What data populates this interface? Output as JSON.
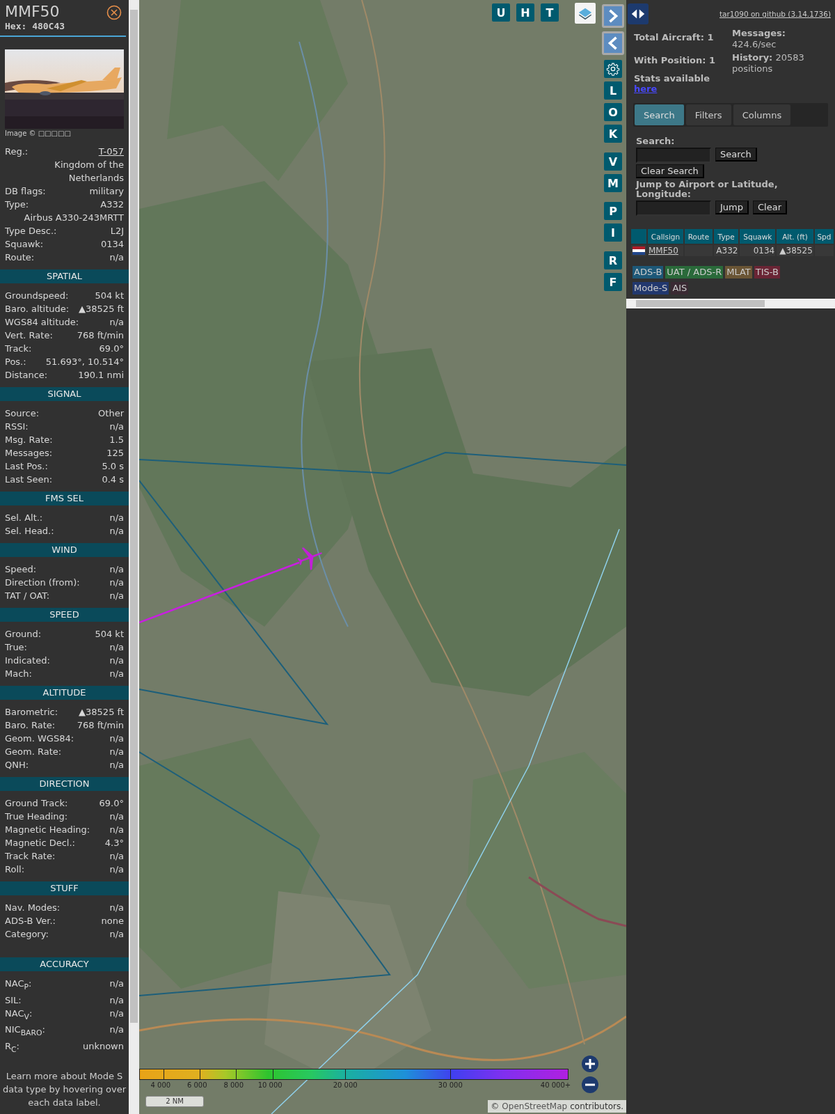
{
  "aircraft": {
    "callsign": "MMF50",
    "hex": "Hex: 480C43",
    "photo_caption": "Image © □□□□□"
  },
  "info_rows": [
    {
      "label": "Reg.:",
      "value": "T-057",
      "link": true
    },
    {
      "value": "Kingdom of the Netherlands"
    },
    {
      "label": "DB flags:",
      "value": "military"
    },
    {
      "label": "Type:",
      "value": "A332"
    },
    {
      "value": "Airbus A330-243MRTT"
    },
    {
      "label": "Type Desc.:",
      "value": "L2J"
    },
    {
      "label": "Squawk:",
      "value": "0134"
    },
    {
      "label": "Route:",
      "value": "n/a"
    }
  ],
  "sections": [
    {
      "title": "SPATIAL",
      "rows": [
        {
          "label": "Groundspeed:",
          "value": "504 kt"
        },
        {
          "label": "Baro. altitude:",
          "value": "▲38525 ft"
        },
        {
          "label": "WGS84 altitude:",
          "value": "n/a"
        },
        {
          "label": "Vert. Rate:",
          "value": "768 ft/min"
        },
        {
          "label": "Track:",
          "value": "69.0°"
        },
        {
          "label": "Pos.:",
          "value": "51.693°, 10.514°"
        },
        {
          "label": "Distance:",
          "value": "190.1 nmi"
        }
      ]
    },
    {
      "title": "SIGNAL",
      "rows": [
        {
          "label": "Source:",
          "value": "Other"
        },
        {
          "label": "RSSI:",
          "value": "n/a"
        },
        {
          "label": "Msg. Rate:",
          "value": "1.5"
        },
        {
          "label": "Messages:",
          "value": "125"
        },
        {
          "label": "Last Pos.:",
          "value": "5.0 s"
        },
        {
          "label": "Last Seen:",
          "value": "0.4 s"
        }
      ]
    },
    {
      "title": "FMS SEL",
      "rows": [
        {
          "label": "Sel. Alt.:",
          "value": "n/a"
        },
        {
          "label": "Sel. Head.:",
          "value": "n/a"
        }
      ]
    },
    {
      "title": "WIND",
      "rows": [
        {
          "label": "Speed:",
          "value": "n/a"
        },
        {
          "label": "Direction (from):",
          "value": "n/a"
        },
        {
          "label": "TAT / OAT:",
          "value": "n/a"
        }
      ]
    },
    {
      "title": "SPEED",
      "rows": [
        {
          "label": "Ground:",
          "value": "504 kt"
        },
        {
          "label": "True:",
          "value": "n/a"
        },
        {
          "label": "Indicated:",
          "value": "n/a"
        },
        {
          "label": "Mach:",
          "value": "n/a"
        }
      ]
    },
    {
      "title": "ALTITUDE",
      "rows": [
        {
          "label": "Barometric:",
          "value": "▲38525 ft"
        },
        {
          "label": "Baro. Rate:",
          "value": "768 ft/min"
        },
        {
          "label": "Geom. WGS84:",
          "value": "n/a"
        },
        {
          "label": "Geom. Rate:",
          "value": "n/a"
        },
        {
          "label": "QNH:",
          "value": "n/a"
        }
      ]
    },
    {
      "title": "DIRECTION",
      "rows": [
        {
          "label": "Ground Track:",
          "value": "69.0°"
        },
        {
          "label": "True Heading:",
          "value": "n/a"
        },
        {
          "label": "Magnetic Heading:",
          "value": "n/a"
        },
        {
          "label": "Magnetic Decl.:",
          "value": "4.3°"
        },
        {
          "label": "Track Rate:",
          "value": "n/a"
        },
        {
          "label": "Roll:",
          "value": "n/a"
        }
      ]
    },
    {
      "title": "STUFF",
      "rows": [
        {
          "label": "Nav. Modes:",
          "value": "n/a"
        },
        {
          "label": "ADS-B Ver.:",
          "value": "none"
        },
        {
          "label": "Category:",
          "value": "n/a"
        }
      ]
    },
    {
      "title": "ACCURACY",
      "rows": [
        {
          "label": "NAC$_{P}$:",
          "value": "n/a"
        },
        {
          "label": "SIL:",
          "value": "n/a"
        },
        {
          "label": "NAC$_{V}$:",
          "value": "n/a"
        },
        {
          "label": "NIC$_{BARO}$:",
          "value": "n/a"
        },
        {
          "label": "R$_{C}$:",
          "value": "unknown"
        }
      ]
    }
  ],
  "note": "Learn more about Mode S data type by hovering over each data label.",
  "map": {
    "top_buttons": [
      "U",
      "H",
      "T"
    ],
    "side_buttons": [
      "L",
      "O",
      "K",
      "V",
      "M",
      "P",
      "I",
      "R",
      "F"
    ],
    "legend_labels": [
      "4 000",
      "6 000",
      "8 000",
      "10 000",
      "20 000",
      "30 000",
      "40 000+"
    ],
    "scale": "2 NM",
    "attribution": {
      "prefix": "©",
      "link": "OpenStreetMap",
      "suffix": "contributors."
    }
  },
  "header_link": "tar1090 on github (3.14.1736)",
  "stats": {
    "total_aircraft": "Total Aircraft: 1",
    "with_position": "With Position: 1",
    "stats_text": "Stats available",
    "stats_link": "here",
    "messages": "**Messages:** 424.6/sec",
    "history": "**History:** 20583 positions"
  },
  "tabs": [
    {
      "label": "Search",
      "selected": true
    },
    {
      "label": "Filters",
      "selected": false
    },
    {
      "label": "Columns",
      "selected": false
    }
  ],
  "search": {
    "label": "Search:",
    "button": "Search",
    "clear_button": "Clear Search",
    "jump_label": "Jump to Airport or Latitude, Longitude:",
    "jump_button": "Jump",
    "jump_clear_button": "Clear"
  },
  "table": {
    "columns": [
      "",
      "Callsign",
      "Route",
      "Type",
      "Squawk",
      "Alt. (ft)",
      "Spd"
    ],
    "rows": [
      {
        "callsign": "MMF50",
        "route": "",
        "type": "A332",
        "squawk": "0134",
        "altitude": "▲38525",
        "speed": ""
      }
    ]
  },
  "source_tags": [
    {
      "label": "ADS-B",
      "color": "#1d5878"
    },
    {
      "label": "UAT / ADS-R",
      "color": "#2a6a3a"
    },
    {
      "label": "MLAT",
      "color": "#6a5535"
    },
    {
      "label": "TIS-B",
      "color": "#6a2535"
    },
    {
      "label": "Mode-S",
      "color": "#22386e"
    },
    {
      "label": "AIS",
      "color": "#3a2a33"
    }
  ]
}
